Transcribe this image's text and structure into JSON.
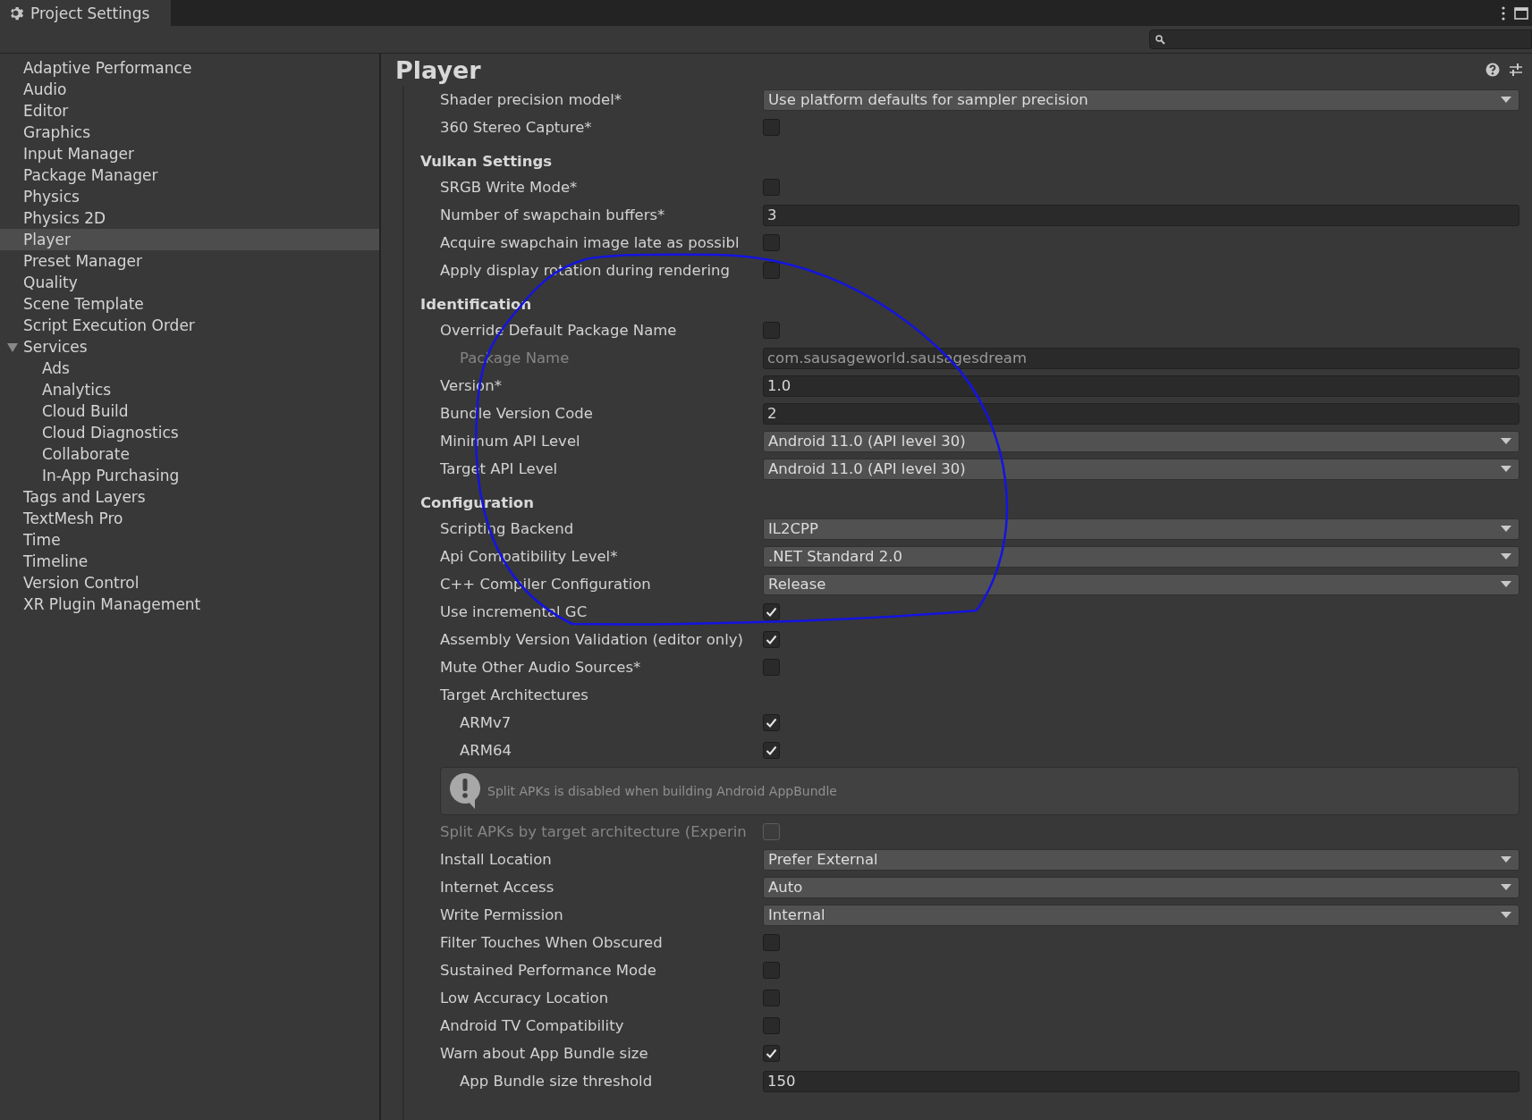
{
  "window": {
    "title": "Project Settings"
  },
  "sidebar": {
    "items": [
      {
        "label": "Adaptive Performance",
        "selected": false
      },
      {
        "label": "Audio",
        "selected": false
      },
      {
        "label": "Editor",
        "selected": false
      },
      {
        "label": "Graphics",
        "selected": false
      },
      {
        "label": "Input Manager",
        "selected": false
      },
      {
        "label": "Package Manager",
        "selected": false
      },
      {
        "label": "Physics",
        "selected": false
      },
      {
        "label": "Physics 2D",
        "selected": false
      },
      {
        "label": "Player",
        "selected": true
      },
      {
        "label": "Preset Manager",
        "selected": false
      },
      {
        "label": "Quality",
        "selected": false
      },
      {
        "label": "Scene Template",
        "selected": false
      },
      {
        "label": "Script Execution Order",
        "selected": false
      },
      {
        "label": "Services",
        "selected": false,
        "expanded": true,
        "children": [
          {
            "label": "Ads",
            "selected": false
          },
          {
            "label": "Analytics",
            "selected": false
          },
          {
            "label": "Cloud Build",
            "selected": false
          },
          {
            "label": "Cloud Diagnostics",
            "selected": false
          },
          {
            "label": "Collaborate",
            "selected": false
          },
          {
            "label": "In-App Purchasing",
            "selected": false
          }
        ]
      },
      {
        "label": "Tags and Layers",
        "selected": false
      },
      {
        "label": "TextMesh Pro",
        "selected": false
      },
      {
        "label": "Time",
        "selected": false
      },
      {
        "label": "Timeline",
        "selected": false
      },
      {
        "label": "Version Control",
        "selected": false
      },
      {
        "label": "XR Plugin Management",
        "selected": false
      }
    ]
  },
  "panel": {
    "title": "Player",
    "rows": [
      {
        "kind": "dropdown",
        "label": "Shader precision model*",
        "value": "Use platform defaults for sampler precision",
        "disabled": false
      },
      {
        "kind": "checkbox",
        "label": "360 Stereo Capture*",
        "checked": false,
        "disabled": false
      },
      {
        "kind": "header",
        "label": "Vulkan Settings"
      },
      {
        "kind": "checkbox",
        "label": "SRGB Write Mode*",
        "checked": false,
        "disabled": false
      },
      {
        "kind": "text",
        "label": "Number of swapchain buffers*",
        "value": "3",
        "disabled": false
      },
      {
        "kind": "checkbox",
        "label": "Acquire swapchain image late as possibl",
        "checked": false,
        "disabled": false
      },
      {
        "kind": "checkbox",
        "label": "Apply display rotation during rendering",
        "checked": false,
        "disabled": false
      },
      {
        "kind": "header",
        "label": "Identification"
      },
      {
        "kind": "checkbox",
        "label": "Override Default Package Name",
        "checked": false,
        "disabled": false,
        "children": [
          {
            "kind": "text",
            "label": "Package Name",
            "value": "com.sausageworld.sausagesdream",
            "disabled": true
          }
        ]
      },
      {
        "kind": "text",
        "label": "Version*",
        "value": "1.0",
        "disabled": false
      },
      {
        "kind": "text",
        "label": "Bundle Version Code",
        "value": "2",
        "disabled": false
      },
      {
        "kind": "dropdown",
        "label": "Minimum API Level",
        "value": "Android 11.0 (API level 30)",
        "disabled": false
      },
      {
        "kind": "dropdown",
        "label": "Target API Level",
        "value": "Android 11.0 (API level 30)",
        "disabled": false
      },
      {
        "kind": "header",
        "label": "Configuration"
      },
      {
        "kind": "dropdown",
        "label": "Scripting Backend",
        "value": "IL2CPP",
        "disabled": false
      },
      {
        "kind": "dropdown",
        "label": "Api Compatibility Level*",
        "value": ".NET Standard 2.0",
        "disabled": false
      },
      {
        "kind": "dropdown",
        "label": "C++ Compiler Configuration",
        "value": "Release",
        "disabled": false
      },
      {
        "kind": "checkbox",
        "label": "Use incremental GC",
        "checked": true,
        "disabled": false
      },
      {
        "kind": "checkbox",
        "label": "Assembly Version Validation (editor only)",
        "checked": true,
        "disabled": false
      },
      {
        "kind": "checkbox",
        "label": "Mute Other Audio Sources*",
        "checked": false,
        "disabled": false
      },
      {
        "kind": "label",
        "label": "Target Architectures",
        "children": [
          {
            "kind": "checkbox",
            "label": "ARMv7",
            "checked": true,
            "disabled": false
          },
          {
            "kind": "checkbox",
            "label": "ARM64",
            "checked": true,
            "disabled": false
          }
        ]
      },
      {
        "kind": "help",
        "label": "Split APKs is disabled when building Android AppBundle"
      },
      {
        "kind": "checkbox",
        "label": "Split APKs by target architecture (Experin",
        "checked": false,
        "disabled": true
      },
      {
        "kind": "dropdown",
        "label": "Install Location",
        "value": "Prefer External",
        "disabled": false
      },
      {
        "kind": "dropdown",
        "label": "Internet Access",
        "value": "Auto",
        "disabled": false
      },
      {
        "kind": "dropdown",
        "label": "Write Permission",
        "value": "Internal",
        "disabled": false
      },
      {
        "kind": "checkbox",
        "label": "Filter Touches When Obscured",
        "checked": false,
        "disabled": false
      },
      {
        "kind": "checkbox",
        "label": "Sustained Performance Mode",
        "checked": false,
        "disabled": false
      },
      {
        "kind": "checkbox",
        "label": "Low Accuracy Location",
        "checked": false,
        "disabled": false
      },
      {
        "kind": "checkbox",
        "label": "Android TV Compatibility",
        "checked": false,
        "disabled": false
      },
      {
        "kind": "checkbox",
        "label": "Warn about App Bundle size",
        "checked": true,
        "disabled": false,
        "children": [
          {
            "kind": "text",
            "label": "App Bundle size threshold",
            "value": "150",
            "disabled": false
          }
        ]
      }
    ]
  }
}
